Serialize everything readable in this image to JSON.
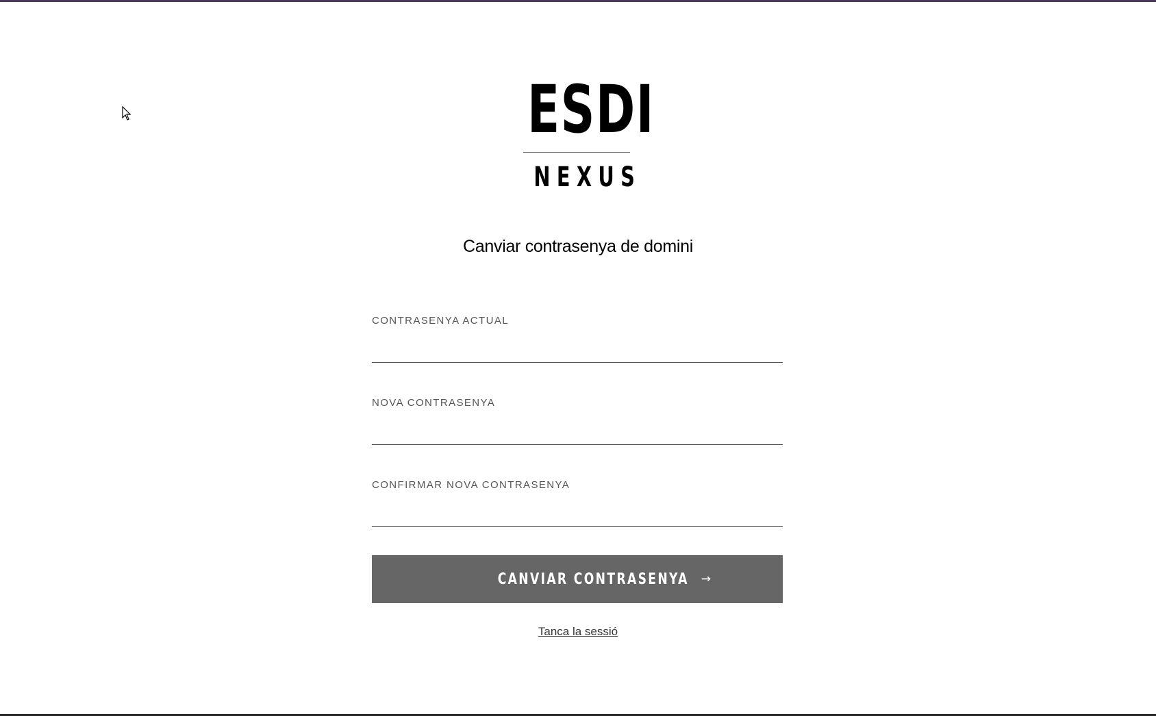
{
  "logo": {
    "main": "ESDI",
    "sub": "NEXUS"
  },
  "page": {
    "title": "Canviar contrasenya de domini"
  },
  "form": {
    "current_password": {
      "label": "CONTRASENYA ACTUAL",
      "value": ""
    },
    "new_password": {
      "label": "NOVA CONTRASENYA",
      "value": ""
    },
    "confirm_password": {
      "label": "CONFIRMAR NOVA CONTRASENYA",
      "value": ""
    },
    "submit_label": "CANVIAR CONTRASENYA",
    "submit_icon": "arrow-right-icon"
  },
  "logout": {
    "label": "Tanca la sessió"
  },
  "colors": {
    "top_bar": "#4a3a5c",
    "button_bg": "#666666",
    "button_text": "#ffffff",
    "label_text": "#555555"
  }
}
